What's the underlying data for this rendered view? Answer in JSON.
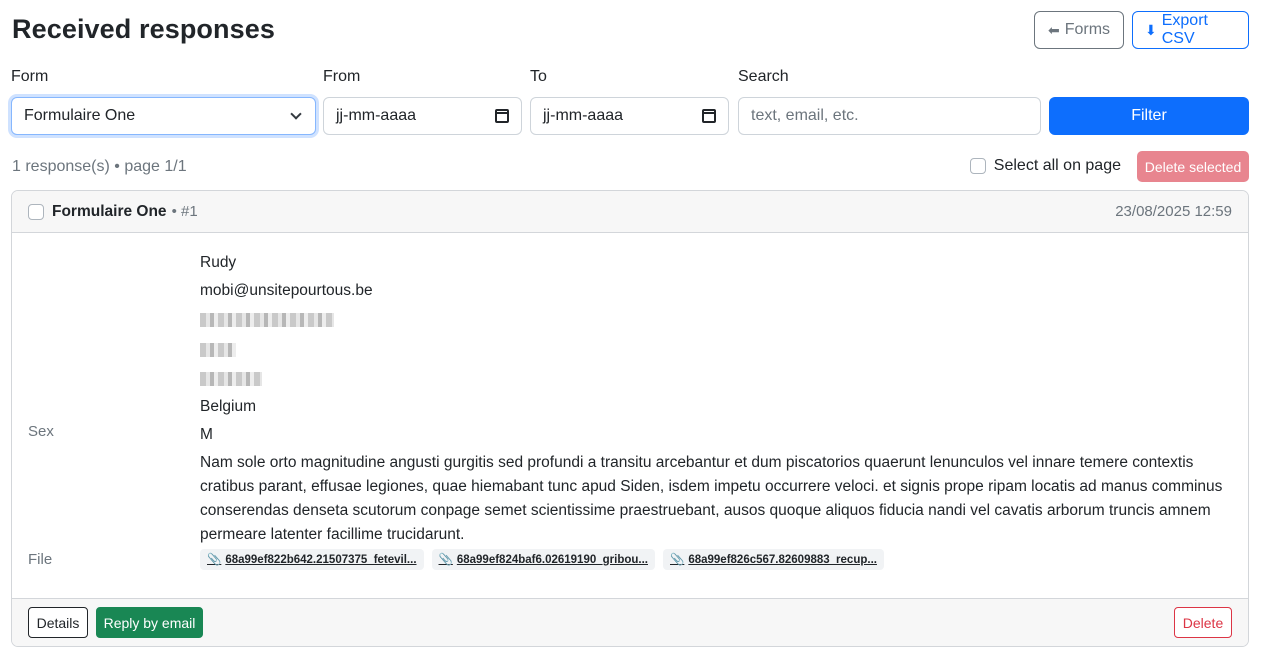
{
  "header": {
    "title": "Received responses",
    "forms_button": "Forms",
    "forms_icon": "arrow-left-icon",
    "export_button": "Export CSV",
    "export_icon": "download-icon"
  },
  "filters": {
    "form_label": "Form",
    "form_selected": "Formulaire One",
    "from_label": "From",
    "from_placeholder": "jj-mm-aaaa",
    "to_label": "To",
    "to_placeholder": "jj-mm-aaaa",
    "search_label": "Search",
    "search_placeholder": "text, email, etc.",
    "filter_button": "Filter"
  },
  "summary": {
    "count_text": "1 response(s) • page 1/1",
    "select_all_label": "Select all on page",
    "delete_selected_button": "Delete selected"
  },
  "response": {
    "form_name": "Formulaire One",
    "number": "• #1",
    "date": "23/08/2025 12:59",
    "fields": {
      "name": "Rudy",
      "email": "mobi@unsitepourtous.be",
      "country": "Belgium",
      "sex_label": "Sex",
      "sex_value": "M",
      "message": "Nam sole orto magnitudine angusti gurgitis sed profundi a transitu arcebantur et dum piscatorios quaerunt lenunculos vel innare temere contextis cratibus parant, effusae legiones, quae hiemabant tunc apud Siden, isdem impetu occurrere veloci. et signis prope ripam locatis ad manus comminus conserendas denseta scutorum conpage semet scientissime praestruebant, ausos quoque aliquos fiducia nandi vel cavatis arborum truncis amnem permeare latenter facillime trucidarunt.",
      "file_label": "File"
    },
    "files": [
      "68a99ef822b642.21507375_fetevil...",
      "68a99ef824baf6.02619190_gribou...",
      "68a99ef826c567.82609883_recup..."
    ],
    "details_button": "Details",
    "reply_button": "Reply by email",
    "delete_button": "Delete"
  },
  "colors": {
    "primary": "#0d6efd",
    "success": "#198754",
    "danger": "#dc3545",
    "muted": "#6c757d"
  }
}
